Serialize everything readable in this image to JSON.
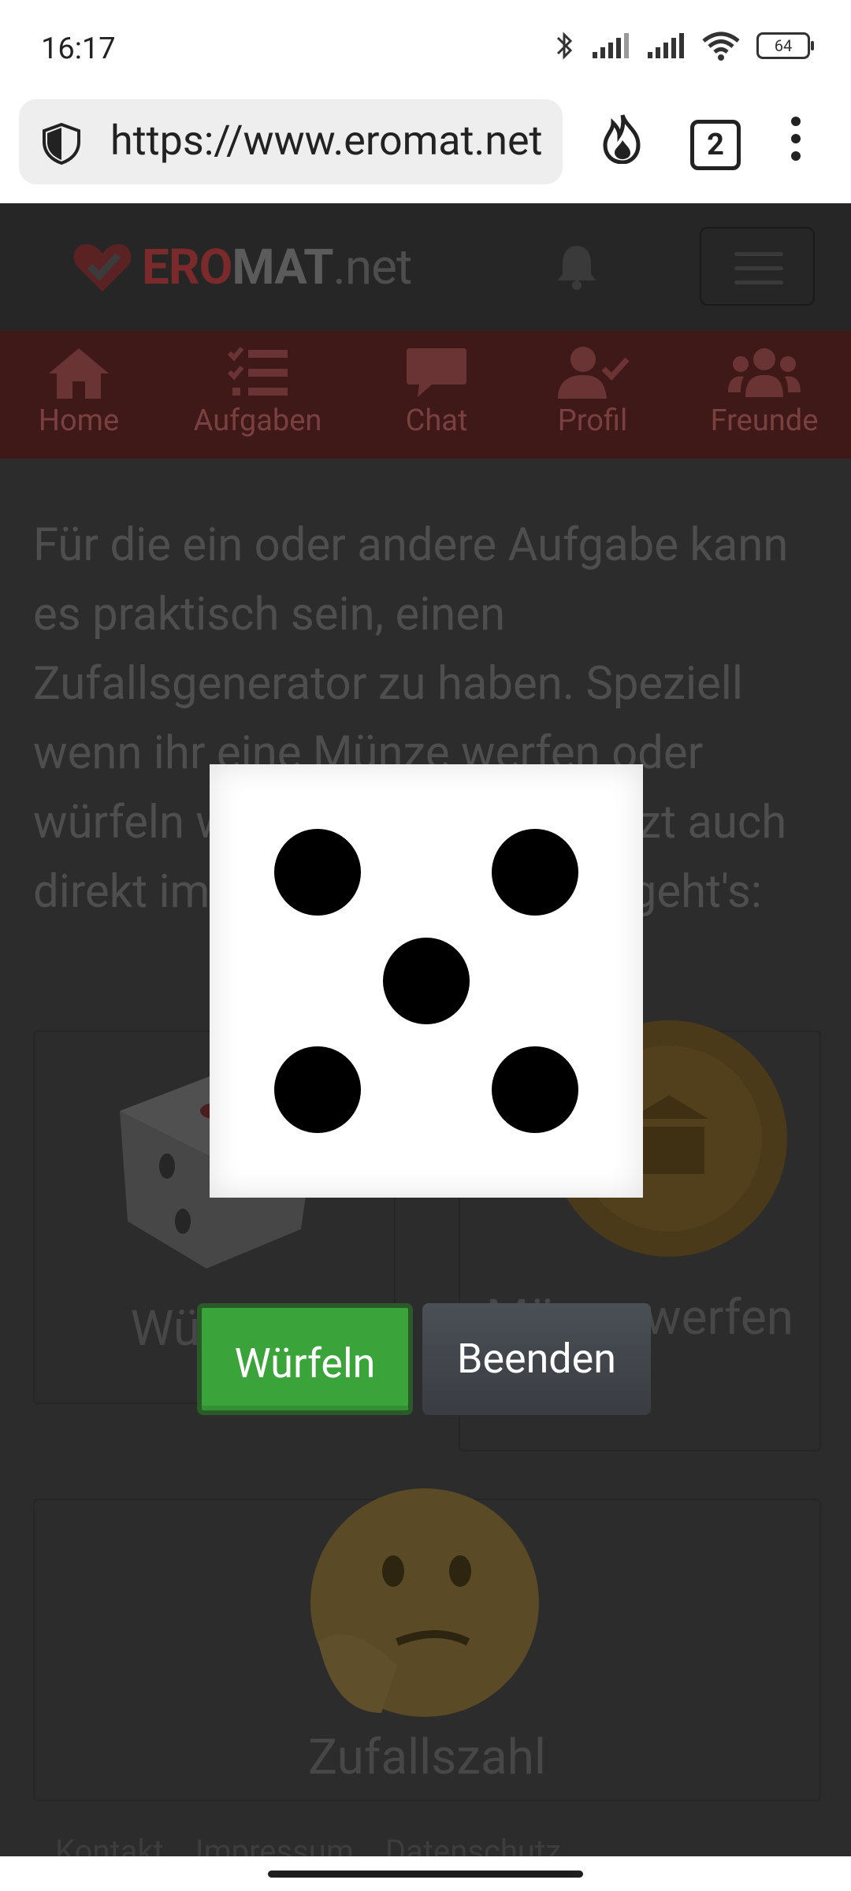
{
  "status": {
    "time": "16:17",
    "battery": "64"
  },
  "browser": {
    "url": "https://www.eromat.net",
    "tab_count": "2"
  },
  "site": {
    "logo": {
      "part1": "ERO",
      "part2": "MAT",
      "part3": ".net"
    },
    "nav": [
      {
        "label": "Home",
        "icon": "home-icon"
      },
      {
        "label": "Aufgaben",
        "icon": "tasks-icon"
      },
      {
        "label": "Chat",
        "icon": "chat-icon"
      },
      {
        "label": "Profil",
        "icon": "profile-icon"
      },
      {
        "label": "Freunde",
        "icon": "friends-icon"
      }
    ],
    "intro": "Für die ein oder andere Aufgabe kann es praktisch sein, einen Zufallsgenerator zu haben. Speziell wenn ihr eine Münze werfen oder würfeln wollt, könnt ihr das jetzt auch direkt im Eromat machen. So geht's:",
    "cards": [
      {
        "label": "Würfeln",
        "icon": "dice-icon"
      },
      {
        "label": "Münze werfen",
        "icon": "coin-icon"
      },
      {
        "label": "Zufallszahl",
        "icon": "thinking-face-icon"
      }
    ],
    "footer": [
      "Kontakt",
      "Impressum",
      "Datenschutz"
    ]
  },
  "modal": {
    "dice_value": 5,
    "roll_label": "Würfeln",
    "end_label": "Beenden"
  },
  "colors": {
    "roll_button": "#3aa33a",
    "end_button": "#41464b",
    "tab_bar": "#3f1818"
  }
}
